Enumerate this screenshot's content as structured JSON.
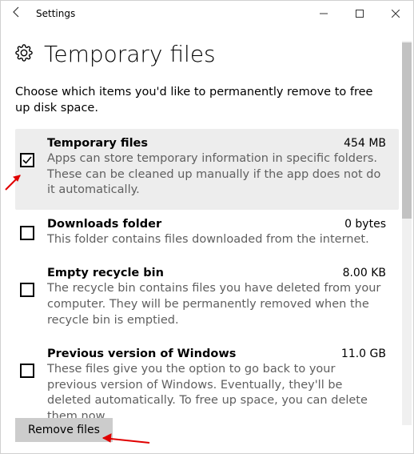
{
  "window": {
    "title": "Settings"
  },
  "header": {
    "title": "Temporary files"
  },
  "intro": "Choose which items you'd like to permanently remove to free up disk space.",
  "items": [
    {
      "checked": true,
      "name": "Temporary files",
      "size": "454 MB",
      "desc": "Apps can store temporary information in specific folders. These can be cleaned up manually if the app does not do it automatically."
    },
    {
      "checked": false,
      "name": "Downloads folder",
      "size": "0 bytes",
      "desc": "This folder contains files downloaded from the internet."
    },
    {
      "checked": false,
      "name": "Empty recycle bin",
      "size": "8.00 KB",
      "desc": "The recycle bin contains files you have deleted from your computer. They will be permanently removed when the recycle bin is emptied."
    },
    {
      "checked": false,
      "name": "Previous version of Windows",
      "size": "11.0 GB",
      "desc": "These files give you the option to go back to your previous version of Windows. Eventually, they'll be deleted automatically. To free up space, you can delete them now."
    }
  ],
  "actions": {
    "remove_label": "Remove files"
  }
}
